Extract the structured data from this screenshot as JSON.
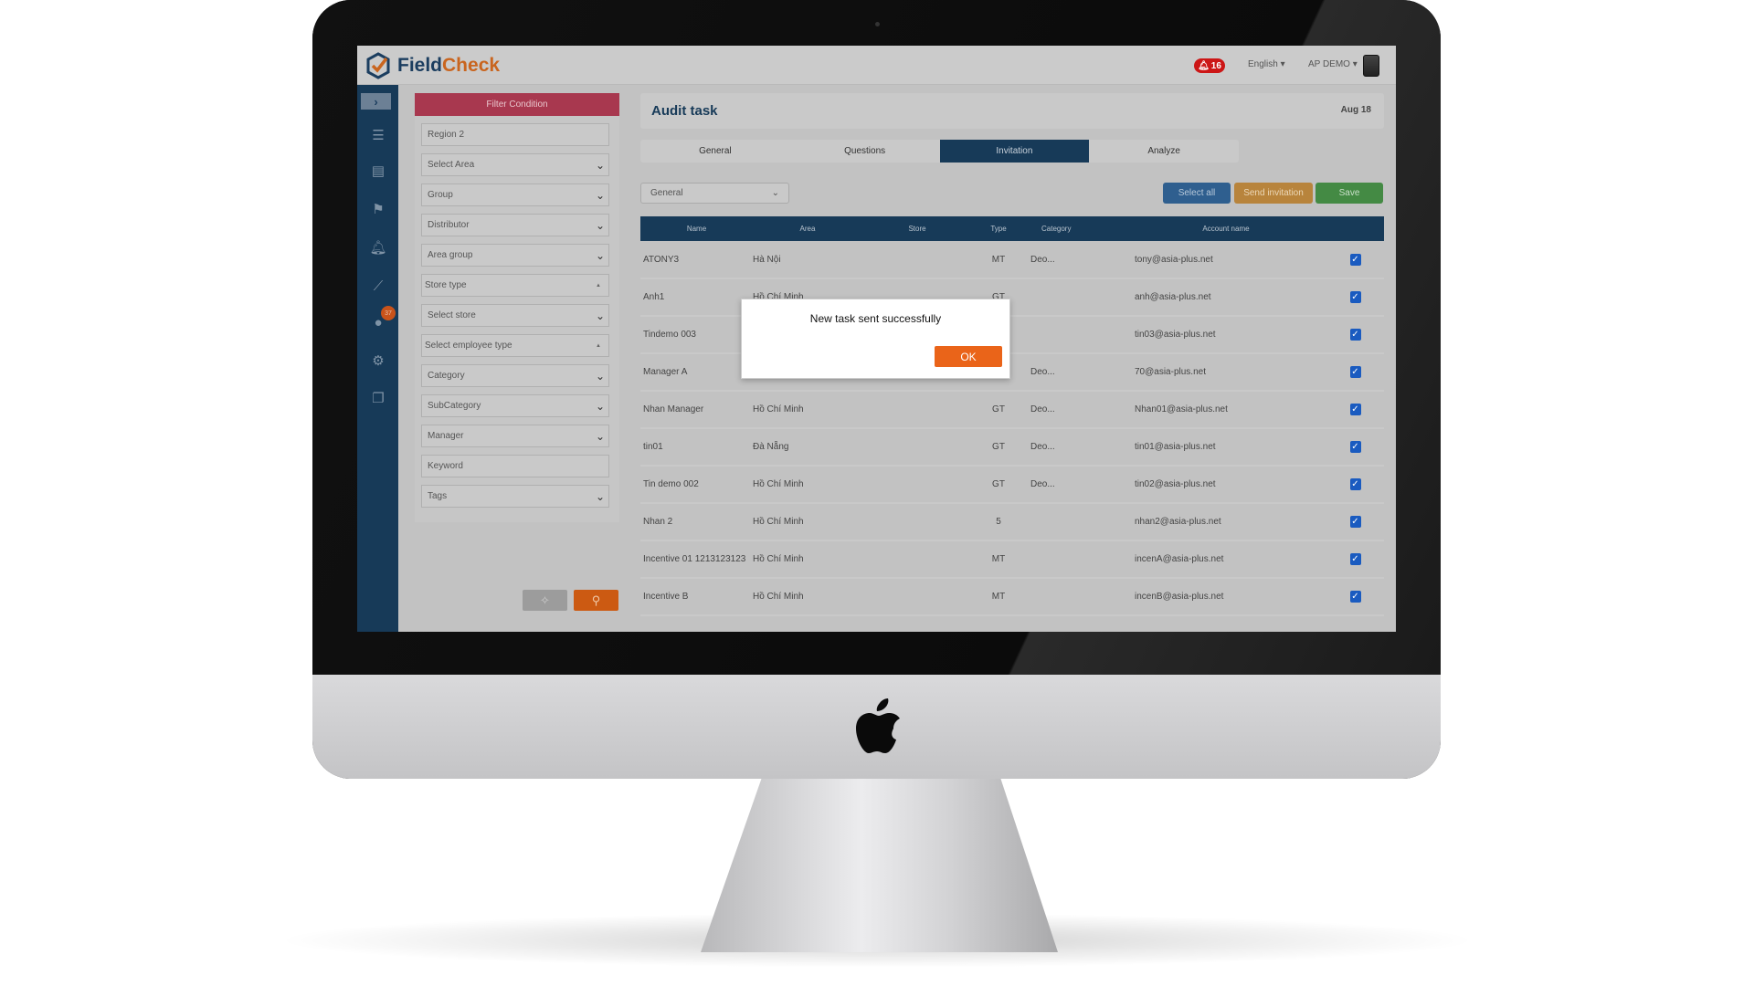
{
  "header": {
    "brand_a": "Field",
    "brand_b": "Check",
    "notif_count": "16",
    "language": "English",
    "user": "AP DEMO"
  },
  "sidebar": {
    "users_badge": "37",
    "icons": [
      "chevron-right-icon",
      "list-icon",
      "clipboard-icon",
      "user-desk-icon",
      "bell-icon",
      "chart-line-icon",
      "user-icon",
      "gears-icon",
      "documents-icon"
    ]
  },
  "filter": {
    "title": "Filter Condition",
    "fields": [
      {
        "label": "Region 2",
        "kind": "input"
      },
      {
        "label": "Select Area",
        "kind": "select"
      },
      {
        "label": "Group",
        "kind": "select"
      },
      {
        "label": "Distributor",
        "kind": "select"
      },
      {
        "label": "Area group",
        "kind": "select"
      },
      {
        "label": "Store type",
        "kind": "multi"
      },
      {
        "label": "Select store",
        "kind": "select"
      },
      {
        "label": "Select employee type",
        "kind": "multi"
      },
      {
        "label": "Category",
        "kind": "select"
      },
      {
        "label": "SubCategory",
        "kind": "select"
      },
      {
        "label": "Manager",
        "kind": "select"
      },
      {
        "label": "Keyword",
        "kind": "input"
      },
      {
        "label": "Tags",
        "kind": "select"
      }
    ]
  },
  "main": {
    "title": "Audit task",
    "date": "Aug 18",
    "tabs": [
      {
        "label": "General"
      },
      {
        "label": "Questions"
      },
      {
        "label": "Invitation",
        "active": true
      },
      {
        "label": "Analyze"
      }
    ],
    "select_value": "General",
    "buttons": {
      "select_all": "Select all",
      "send_invitation": "Send invitation",
      "save": "Save"
    },
    "columns": [
      "Name",
      "Area",
      "Store",
      "Type",
      "Category",
      "Account name"
    ],
    "rows": [
      {
        "name": "ATONY3",
        "area": "Hà Nội",
        "store": "",
        "type": "MT",
        "category": "Deo...",
        "account": "tony@asia-plus.net",
        "checked": true
      },
      {
        "name": "Anh1",
        "area": "Hồ Chí Minh",
        "store": "",
        "type": "GT",
        "category": "",
        "account": "anh@asia-plus.net",
        "checked": true
      },
      {
        "name": "Tindemo 003",
        "area": "",
        "store": "",
        "type": "",
        "category": "",
        "account": "tin03@asia-plus.net",
        "checked": true
      },
      {
        "name": "Manager A",
        "area": "",
        "store": "",
        "type": "",
        "category": "Deo...",
        "account": "70@asia-plus.net",
        "checked": true
      },
      {
        "name": "Nhan Manager",
        "area": "Hồ Chí Minh",
        "store": "",
        "type": "GT",
        "category": "Deo...",
        "account": "Nhan01@asia-plus.net",
        "checked": true
      },
      {
        "name": "tin01",
        "area": "Đà Nẵng",
        "store": "",
        "type": "GT",
        "category": "Deo...",
        "account": "tin01@asia-plus.net",
        "checked": true
      },
      {
        "name": "Tin demo 002",
        "area": "Hồ Chí Minh",
        "store": "",
        "type": "GT",
        "category": "Deo...",
        "account": "tin02@asia-plus.net",
        "checked": true
      },
      {
        "name": "Nhan 2",
        "area": "Hồ Chí Minh",
        "store": "",
        "type": "5",
        "category": "",
        "account": "nhan2@asia-plus.net",
        "checked": true
      },
      {
        "name": "Incentive 01 1213123123",
        "area": "Hồ Chí Minh",
        "store": "",
        "type": "MT",
        "category": "",
        "account": "incenA@asia-plus.net",
        "checked": true
      },
      {
        "name": "Incentive B",
        "area": "Hồ Chí Minh",
        "store": "",
        "type": "MT",
        "category": "",
        "account": "incenB@asia-plus.net",
        "checked": true
      }
    ]
  },
  "modal": {
    "message": "New task sent successfully",
    "ok": "OK"
  },
  "colors": {
    "navy": "#173a58",
    "filter_red": "#a8384f",
    "orange": "#ea6419",
    "select_all": "#2f5f8f",
    "send_invitation": "#b8843c",
    "save": "#448a44"
  }
}
